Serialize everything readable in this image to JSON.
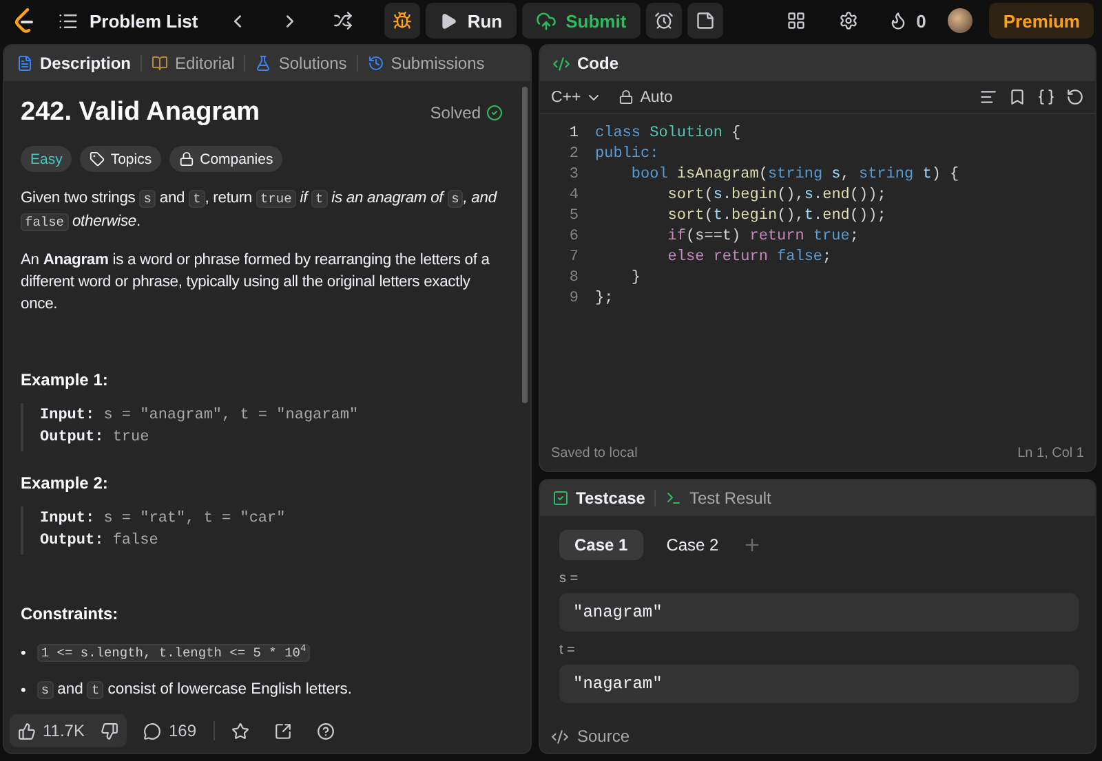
{
  "top_bar": {
    "problem_list": "Problem List",
    "run": "Run",
    "submit": "Submit",
    "streak": "0",
    "premium": "Premium"
  },
  "description_panel": {
    "tabs": [
      {
        "label": "Description",
        "kind": "description",
        "selected": true
      },
      {
        "label": "Editorial",
        "kind": "editorial",
        "selected": false
      },
      {
        "label": "Solutions",
        "kind": "solutions",
        "selected": false
      },
      {
        "label": "Submissions",
        "kind": "submissions",
        "selected": false
      }
    ],
    "title": "242. Valid Anagram",
    "status": "Solved",
    "tags": [
      {
        "label": "Easy",
        "kind": "difficulty"
      },
      {
        "label": "Topics",
        "kind": "topics"
      },
      {
        "label": "Companies",
        "kind": "companies"
      }
    ],
    "paragraphs": [
      [
        {
          "kind": "text",
          "text": "Given two strings "
        },
        {
          "kind": "code",
          "text": "s"
        },
        {
          "kind": "text",
          "text": " and "
        },
        {
          "kind": "code",
          "text": "t"
        },
        {
          "kind": "text",
          "text": ", return "
        },
        {
          "kind": "code",
          "text": "true"
        },
        {
          "kind": "italic",
          "text": " if "
        },
        {
          "kind": "code",
          "text": "t"
        },
        {
          "kind": "italic",
          "text": " is an anagram of "
        },
        {
          "kind": "code",
          "text": "s"
        },
        {
          "kind": "italic",
          "text": ", and "
        },
        {
          "kind": "code",
          "text": "false"
        },
        {
          "kind": "italic",
          "text": " otherwise"
        },
        {
          "kind": "text",
          "text": "."
        }
      ],
      [
        {
          "kind": "text",
          "text": "An "
        },
        {
          "kind": "bold",
          "text": "Anagram"
        },
        {
          "kind": "text",
          "text": " is a word or phrase formed by rearranging the letters of a different word or phrase, typically using all the original letters exactly once."
        }
      ]
    ],
    "examples": [
      {
        "title": "Example 1:",
        "input_label": "Input:",
        "input": "s = \"anagram\", t = \"nagaram\"",
        "output_label": "Output:",
        "output": "true"
      },
      {
        "title": "Example 2:",
        "input_label": "Input:",
        "input": "s = \"rat\", t = \"car\"",
        "output_label": "Output:",
        "output": "false"
      }
    ],
    "constraints_title": "Constraints:",
    "constraints": [
      {
        "bullet": "•",
        "segments": [
          {
            "kind": "code",
            "text": "1 <= s.length, t.length <= 5 * 10$^{4}$"
          }
        ]
      },
      {
        "bullet": "•",
        "segments": [
          {
            "kind": "code",
            "text": "s"
          },
          {
            "kind": "text",
            "text": " and "
          },
          {
            "kind": "code",
            "text": "t"
          },
          {
            "kind": "text",
            "text": " consist of lowercase English letters."
          }
        ]
      }
    ],
    "footer": {
      "likes": "11.7K",
      "comments": "169"
    }
  },
  "code_panel": {
    "title": "Code",
    "language": "C++",
    "mode": "Auto",
    "lines": [
      {
        "number": "1",
        "tokens": [
          {
            "kind": "keyword",
            "text": "class "
          },
          {
            "kind": "type",
            "text": "Solution"
          },
          {
            "kind": "plain",
            "text": " {"
          }
        ]
      },
      {
        "number": "2",
        "tokens": [
          {
            "kind": "keyword",
            "text": "public:"
          }
        ]
      },
      {
        "number": "3",
        "tokens": [
          {
            "kind": "keyword",
            "text": "    bool "
          },
          {
            "kind": "function",
            "text": "isAnagram"
          },
          {
            "kind": "plain",
            "text": "("
          },
          {
            "kind": "keyword",
            "text": "string "
          },
          {
            "kind": "variable",
            "text": "s"
          },
          {
            "kind": "plain",
            "text": ", "
          },
          {
            "kind": "keyword",
            "text": "string "
          },
          {
            "kind": "variable",
            "text": "t"
          },
          {
            "kind": "plain",
            "text": ") {"
          }
        ]
      },
      {
        "number": "4",
        "tokens": [
          {
            "kind": "function",
            "text": "        sort"
          },
          {
            "kind": "plain",
            "text": "("
          },
          {
            "kind": "variable",
            "text": "s"
          },
          {
            "kind": "plain",
            "text": "."
          },
          {
            "kind": "function",
            "text": "begin"
          },
          {
            "kind": "plain",
            "text": "(),"
          },
          {
            "kind": "variable",
            "text": "s"
          },
          {
            "kind": "plain",
            "text": "."
          },
          {
            "kind": "function",
            "text": "end"
          },
          {
            "kind": "plain",
            "text": "());"
          }
        ]
      },
      {
        "number": "5",
        "tokens": [
          {
            "kind": "function",
            "text": "        sort"
          },
          {
            "kind": "plain",
            "text": "("
          },
          {
            "kind": "variable",
            "text": "t"
          },
          {
            "kind": "plain",
            "text": "."
          },
          {
            "kind": "function",
            "text": "begin"
          },
          {
            "kind": "plain",
            "text": "(),"
          },
          {
            "kind": "variable",
            "text": "t"
          },
          {
            "kind": "plain",
            "text": "."
          },
          {
            "kind": "function",
            "text": "end"
          },
          {
            "kind": "plain",
            "text": "());"
          }
        ]
      },
      {
        "number": "6",
        "tokens": [
          {
            "kind": "control",
            "text": "        if"
          },
          {
            "kind": "plain",
            "text": "(s==t) "
          },
          {
            "kind": "control",
            "text": "return "
          },
          {
            "kind": "constant",
            "text": "true"
          },
          {
            "kind": "plain",
            "text": ";"
          }
        ]
      },
      {
        "number": "7",
        "tokens": [
          {
            "kind": "control",
            "text": "        else return "
          },
          {
            "kind": "constant",
            "text": "false"
          },
          {
            "kind": "plain",
            "text": ";"
          }
        ]
      },
      {
        "number": "8",
        "tokens": [
          {
            "kind": "plain",
            "text": "    }"
          }
        ]
      },
      {
        "number": "9",
        "tokens": [
          {
            "kind": "plain",
            "text": "};"
          }
        ]
      }
    ],
    "status": "Saved to local",
    "cursor": "Ln 1, Col 1"
  },
  "testcase_panel": {
    "tabs": [
      {
        "label": "Testcase",
        "kind": "testcase",
        "selected": true
      },
      {
        "label": "Test Result",
        "kind": "result",
        "selected": false
      }
    ],
    "cases": [
      {
        "label": "Case 1",
        "selected": true
      },
      {
        "label": "Case 2",
        "selected": false
      }
    ],
    "params": [
      {
        "name": "s =",
        "value": "\"anagram\""
      },
      {
        "name": "t =",
        "value": "\"nagaram\""
      }
    ],
    "footer": "Source"
  }
}
